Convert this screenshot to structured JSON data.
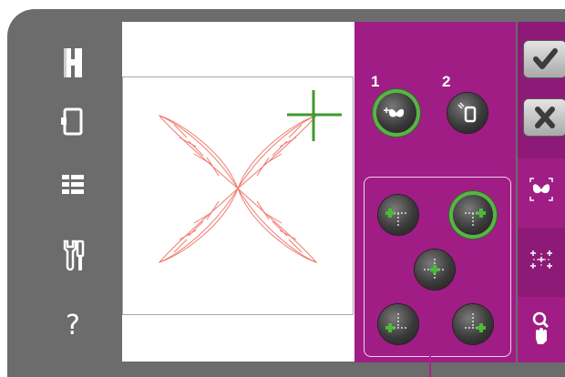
{
  "left_rail": {
    "help_label": "?"
  },
  "modes": {
    "mode1_label": "1",
    "mode2_label": "2"
  },
  "colors": {
    "panel": "#a01d85",
    "sidebar": "#8c1a76",
    "frame_gray": "#6c6c6c",
    "active_ring": "#5bb347",
    "design_stroke": "#f07a6e",
    "crosshair": "#3f9a2f"
  },
  "icons": {
    "rail": [
      "home-icon",
      "hoop-icon",
      "list-menu-icon",
      "tools-icon",
      "help-icon"
    ],
    "positioning": [
      "position-top-left-icon",
      "position-top-right-icon",
      "position-center-icon",
      "position-bottom-left-icon",
      "position-bottom-right-icon"
    ],
    "side": [
      "confirm-check-icon",
      "cancel-x-icon",
      "design-selection-icon",
      "grid-align-icon",
      "zoom-pan-icon"
    ]
  }
}
